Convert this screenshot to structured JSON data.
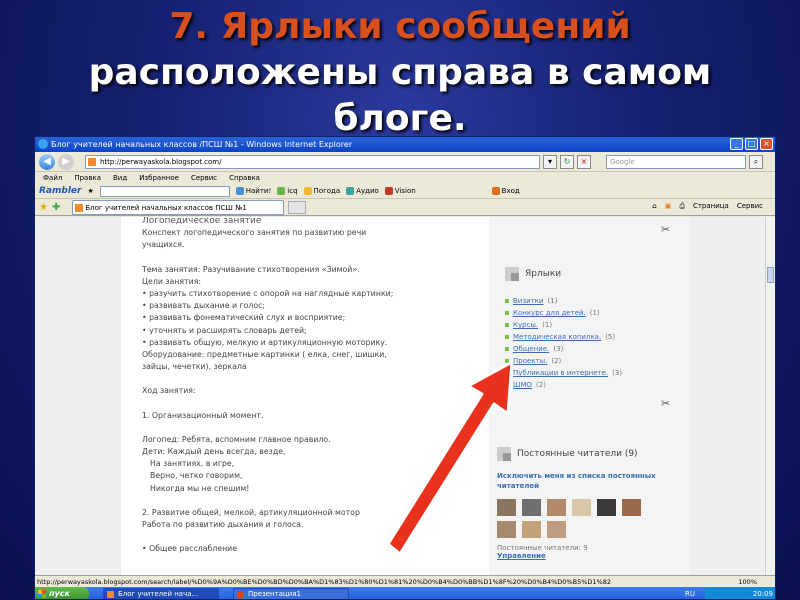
{
  "slide": {
    "title_accent": "7. Ярлыки сообщений",
    "title_line2": "расположены справа в самом",
    "title_line3": "блоге."
  },
  "browser": {
    "window_title": "Блог учителей начальных классов /ПСШ №1 - Windows Internet Explorer",
    "url": "http://perwayaskola.blogspot.com/",
    "search_placeholder": "Google",
    "menu": [
      "Файл",
      "Правка",
      "Вид",
      "Избранное",
      "Сервис",
      "Справка"
    ],
    "rambler": {
      "logo": "Rambler",
      "find_label": "Найти!",
      "items": [
        "icq",
        "Погода",
        "Аудио",
        "Vision",
        "Вход"
      ]
    },
    "tab_label": "Блог учителей начальных классов ПСШ №1",
    "commands": [
      "Страница",
      "Сервис"
    ],
    "status_url": "http://perwayaskola.blogspot.com/search/label/%D0%9A%D0%BE%D0%BD%D0%BA%D1%83%D1%80%D1%81%20%D0%B4%D0%BB%D1%8F%20%D0%B4%D0%B5%D1%82",
    "zoom": "100%"
  },
  "post": {
    "title": "Логопедическое занятие",
    "lines": [
      "Конспект логопедического занятия по развитию речи",
      "учащихся.",
      "",
      "Тема занятия: Разучивание стихотворения «Зимой».",
      "Цели занятия:",
      "• разучить стихотворение с опорой на наглядные картинки;",
      "• развивать дыхание и голос;",
      "• развивать фонематический слух и восприятие;",
      "• уточнять и расширять словарь детей;",
      "• развивать общую, мелкую и артикуляционную моторику.",
      "Оборудование: предметные картинки ( елка, снег, шишки,",
      "зайцы, чечетки), зеркала",
      "",
      "Ход занятия:",
      "",
      "1. Организационный момент.",
      "",
      "Логопед: Ребята, вспомним главное правило.",
      "Дети: Каждый день всегда, везде,",
      "   На занятиях, в игре,",
      "   Верно, четко говорим,",
      "   Никогда мы не спешим!",
      "",
      "2. Развитие общей, мелкой, артикуляционной мотор",
      "Работа по развитию дыхания и голоса.",
      "",
      "• Общее расслабление"
    ]
  },
  "sidebar": {
    "labels_title": "Ярлыки",
    "labels": [
      {
        "name": "Визитки",
        "count": "(1)"
      },
      {
        "name": "Конкурс для детей.",
        "count": "(1)"
      },
      {
        "name": "Курсы.",
        "count": "(1)"
      },
      {
        "name": "Методическая копилка.",
        "count": "(5)"
      },
      {
        "name": "Общение.",
        "count": "(3)"
      },
      {
        "name": "Проекты.",
        "count": "(2)"
      },
      {
        "name": "Публикации в интернете.",
        "count": "(3)"
      },
      {
        "name": "ШМО",
        "count": "(2)"
      }
    ],
    "followers_title": "Постоянные читатели (9)",
    "exclude_link": "Исключить меня из списка постоянных читателей",
    "followers_count": "Постоянные читатели: 9",
    "manage_link": "Управление"
  },
  "taskbar": {
    "start": "пуск",
    "tasks": [
      "Блог учителей нача...",
      "Презентация1"
    ],
    "lang": "RU",
    "clock": "20:09"
  },
  "colors": {
    "slide_bg": "#152070",
    "title_accent": "#d8501e",
    "arrow": "#e8321e",
    "label_bullet": "#7bc043",
    "link": "#3a6fb0"
  }
}
